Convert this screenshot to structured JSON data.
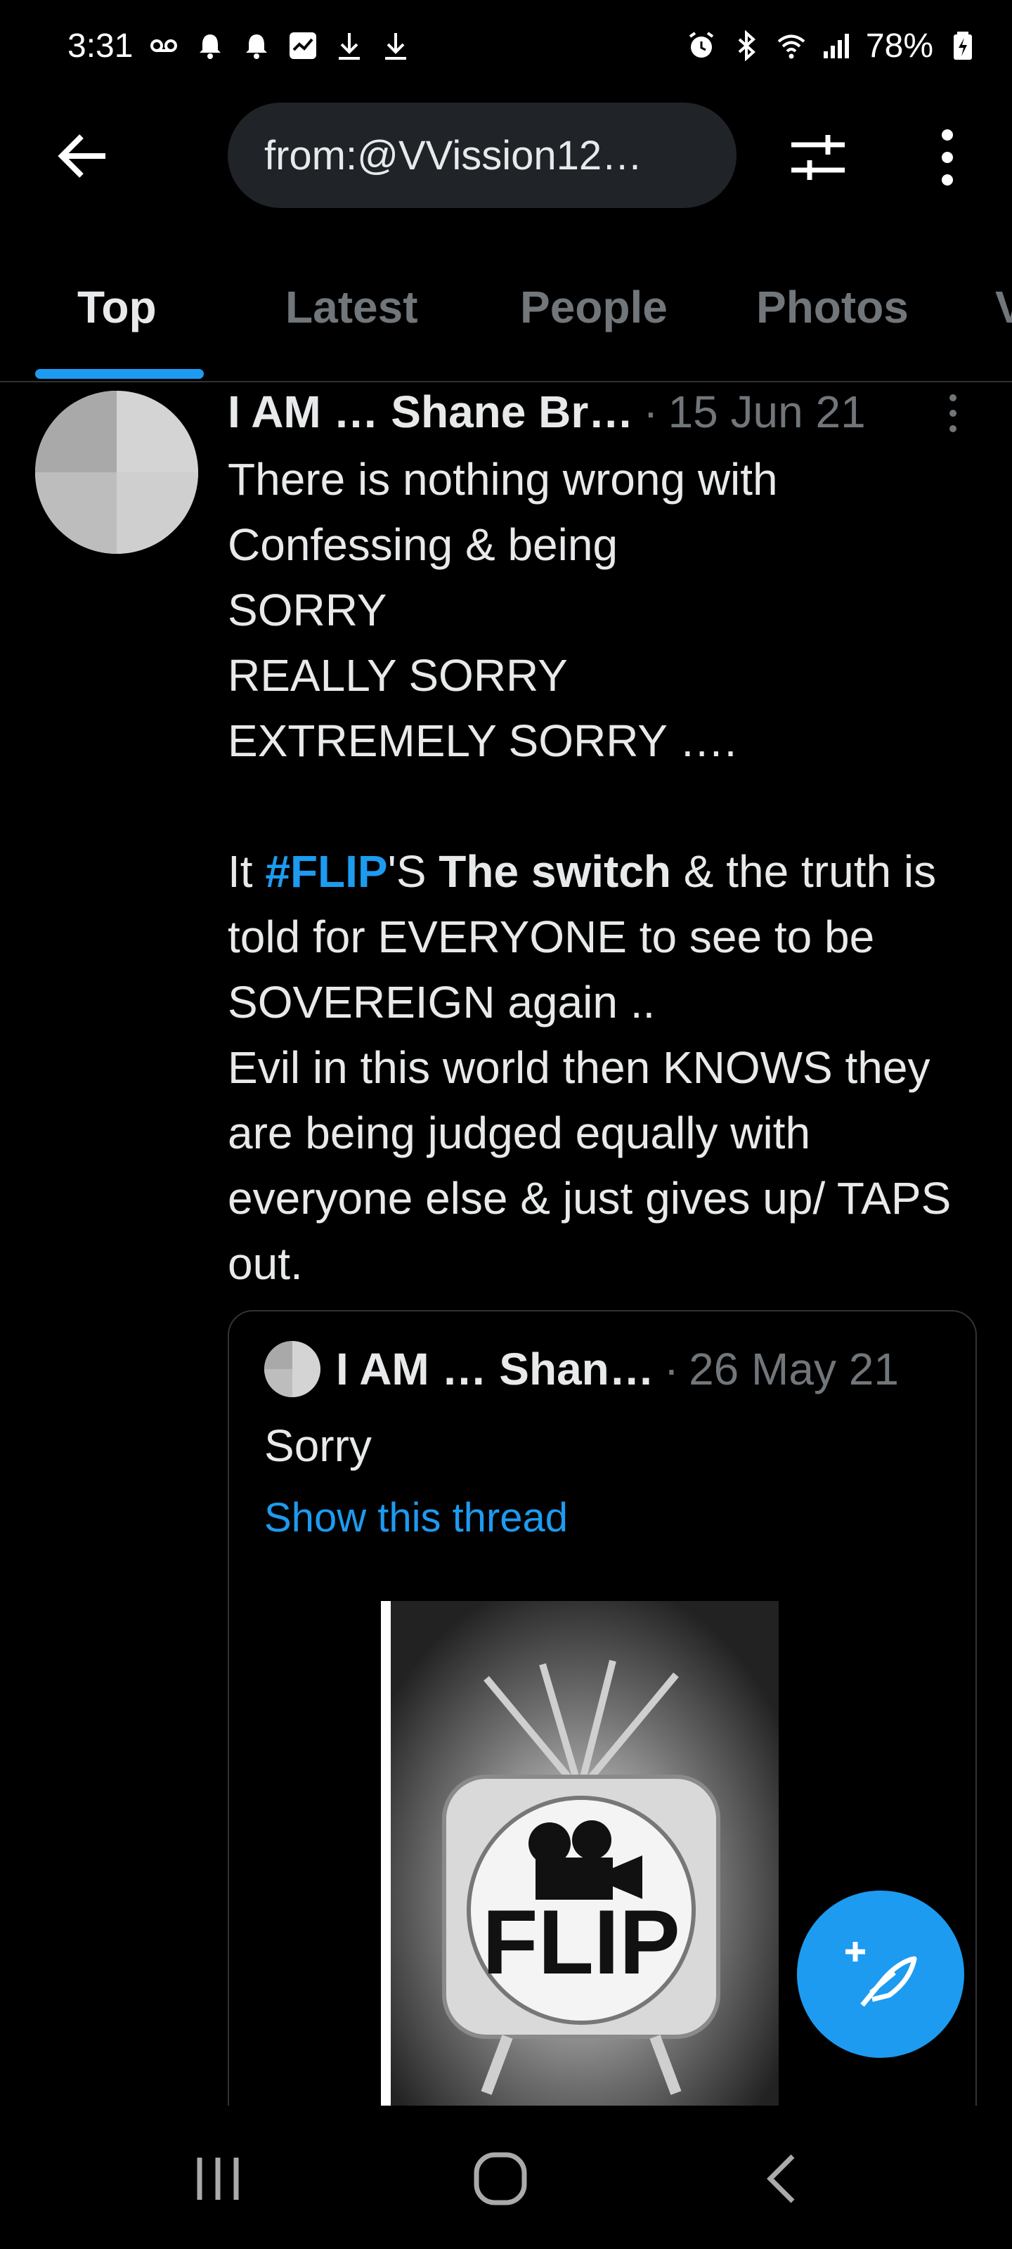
{
  "status_bar": {
    "time": "3:31",
    "battery": "78%",
    "icons": [
      "voicemail-icon",
      "bell-icon",
      "bell-icon",
      "chart-icon",
      "download-icon",
      "download-icon",
      "alarm-icon",
      "bluetooth-icon",
      "wifi-icon",
      "signal-icon",
      "battery-icon"
    ]
  },
  "app_bar": {
    "search_query": "from:@VVission12…"
  },
  "tabs": [
    {
      "label": "Top",
      "active": true
    },
    {
      "label": "Latest",
      "active": false
    },
    {
      "label": "People",
      "active": false
    },
    {
      "label": "Photos",
      "active": false
    },
    {
      "label": "V",
      "active": false
    }
  ],
  "tweet": {
    "author": "I AM … Shane Br…",
    "separator": "·",
    "date": "15 Jun 21",
    "body_lines": [
      "There is nothing wrong with",
      "Confessing & being",
      "SORRY",
      "REALLY SORRY",
      "EXTREMELY SORRY …."
    ],
    "body2_prefix": "It ",
    "hashtag": "#FLIP",
    "body2_mid": "'S ",
    "body2_bold": "The switch",
    "body2_rest": " & the truth is told for EVERYONE to see to be SOVEREIGN again ..\nEvil in this world then KNOWS they are being judged equally with everyone else & just gives up/ TAPS out.",
    "quote": {
      "author": "I AM … Shan…",
      "separator": "·",
      "date": "26 May 21",
      "text": "Sorry",
      "thread_link": "Show this thread",
      "image_label": "FLIP"
    }
  },
  "colors": {
    "accent": "#1d9bf0",
    "background": "#000000",
    "muted_text": "#71767b",
    "text": "#e7e9ea"
  }
}
